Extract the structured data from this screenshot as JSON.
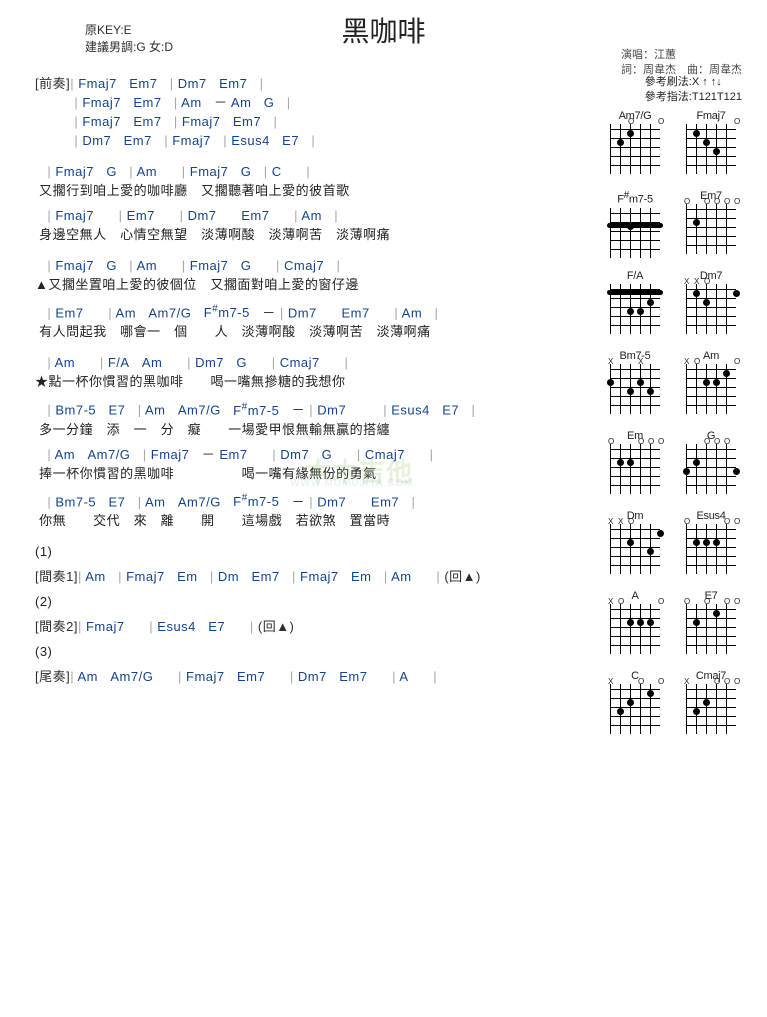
{
  "title": "黑咖啡",
  "meta": {
    "key_line1": "原KEY:E",
    "key_line2": "建議男調:G 女:D",
    "singer": "演唱：江蕙",
    "lyricist": "詞：周韋杰　曲：周韋杰"
  },
  "reference": {
    "strum": "參考刷法:X ↑ ↑↓",
    "pick": "參考指法:T121T121"
  },
  "sections": [
    {
      "type": "intro",
      "label": "[前奏]",
      "lines": [
        {
          "chords": [
            "|",
            "Fmaj7",
            "Em7",
            "|",
            "Dm7",
            "Em7",
            "|"
          ]
        },
        {
          "chords": [
            "|",
            "Fmaj7",
            "Em7",
            "|",
            "Am",
            "－",
            "Am",
            "G",
            "|"
          ]
        },
        {
          "chords": [
            "|",
            "Fmaj7",
            "Em7",
            "|",
            "Fmaj7",
            "Em7",
            "|"
          ]
        },
        {
          "chords": [
            "|",
            "Dm7",
            "Em7",
            "|",
            "Fmaj7",
            "|",
            "Esus4",
            "E7",
            "|"
          ]
        }
      ]
    },
    {
      "type": "verse",
      "lines": [
        {
          "chords": [
            "|",
            "Fmaj7",
            "G",
            "|",
            "Am",
            "",
            "|",
            "Fmaj7",
            "G",
            "|",
            "C",
            "",
            "|"
          ],
          "lyrics": "又擱行到咱上愛的咖啡廳　又擱聽著咱上愛的彼首歌"
        },
        {
          "chords": [
            "|",
            "Fmaj7",
            "",
            "|",
            "Em7",
            "",
            "|",
            "Dm7",
            "",
            "Em7",
            "",
            "|",
            "Am",
            "|"
          ],
          "lyrics": "身邊空無人　心情空無望　淡薄啊酸　淡薄啊苦　淡薄啊痛"
        }
      ]
    },
    {
      "type": "verse",
      "marker": "▲",
      "lines": [
        {
          "chords": [
            "|",
            "Fmaj7",
            "G",
            "|",
            "Am",
            "",
            "|",
            "Fmaj7",
            "G",
            "",
            "|",
            "Cmaj7",
            "|"
          ],
          "lyrics": "又擱坐置咱上愛的彼個位　又擱面對咱上愛的窗仔邊"
        },
        {
          "chords": [
            "|",
            "Em7",
            "",
            "|",
            "Am",
            "Am7/G",
            "F#m7-5",
            "－",
            "|",
            "Dm7",
            "",
            "Em7",
            "",
            "|",
            "Am",
            "|"
          ],
          "lyrics": "有人問起我　哪會一　個　　人　淡薄啊酸　淡薄啊苦　淡薄啊痛"
        }
      ]
    },
    {
      "type": "chorus",
      "marker": "★",
      "lines": [
        {
          "chords": [
            "|",
            "Am",
            "",
            "|",
            "F/A",
            "Am",
            "",
            "|",
            "Dm7",
            "G",
            "",
            "|",
            "Cmaj7",
            "",
            "|"
          ],
          "lyrics": "點一杯你慣習的黑咖啡　　喝一嘴無摻糖的我想你"
        },
        {
          "chords": [
            "|",
            "Bm7-5",
            "E7",
            "|",
            "Am",
            "Am7/G",
            "F#m7-5",
            "－",
            "|",
            "Dm7",
            "",
            "",
            "|",
            "Esus4",
            "E7",
            "|"
          ],
          "lyrics": "多一分鐘　添　一　分　癡　　一場愛甲恨無輸無贏的搭纏"
        },
        {
          "chords": [
            "|",
            "Am",
            "Am7/G",
            "|",
            "Fmaj7",
            "－",
            "Em7",
            "",
            "|",
            "Dm7",
            "G",
            "",
            "|",
            "Cmaj7",
            "",
            "|"
          ],
          "lyrics": "捧一杯你慣習的黑咖啡　　　　　喝一嘴有緣無份的勇氣"
        },
        {
          "chords": [
            "|",
            "Bm7-5",
            "E7",
            "|",
            "Am",
            "Am7/G",
            "F#m7-5",
            "－",
            "|",
            "Dm7",
            "",
            "Em7",
            "|"
          ],
          "lyrics": "你無　　交代　來　離　　開　　這場戲　若欲煞　置當時"
        }
      ]
    },
    {
      "type": "route",
      "label": "(1)",
      "lines": [
        {
          "chords": [
            "[間奏1]",
            "|",
            "Am",
            "|",
            "Fmaj7",
            "Em",
            "|",
            "Dm",
            "Em7",
            "|",
            "Fmaj7",
            "Em",
            "|",
            "Am",
            "",
            "|",
            " (回▲)"
          ]
        }
      ]
    },
    {
      "type": "route",
      "label": "(2)",
      "lines": [
        {
          "chords": [
            "[間奏2]",
            "|",
            "Fmaj7",
            "",
            "|",
            "Esus4",
            "E7",
            "",
            "|",
            " (回▲)"
          ]
        }
      ]
    },
    {
      "type": "route",
      "label": "(3)",
      "lines": [
        {
          "chords": [
            "[尾奏]",
            "|",
            "Am",
            "Am7/G",
            "",
            "|",
            "Fmaj7",
            "Em7",
            "",
            "|",
            "Dm7",
            "Em7",
            "",
            "|",
            "A",
            "",
            "|"
          ]
        }
      ]
    }
  ],
  "watermark": {
    "main": "木木吉他",
    "sub": "WWW.MUMUJITA.COM"
  },
  "diagrams": [
    {
      "name": "Am7/G",
      "dots": [
        [
          1,
          3
        ],
        [
          2,
          2
        ]
      ],
      "barre": null,
      "xo": [
        "",
        "",
        "O",
        "",
        "",
        "O"
      ]
    },
    {
      "name": "Fmaj7",
      "dots": [
        [
          1,
          2
        ],
        [
          2,
          3
        ],
        [
          3,
          4
        ]
      ],
      "barre": null,
      "xo": [
        "",
        "",
        "",
        "",
        "",
        "O"
      ]
    },
    {
      "name": "F#m7-5",
      "dots": [],
      "barre": [
        2,
        1,
        6
      ],
      "xo": [
        "",
        "",
        "",
        "",
        "",
        ""
      ],
      "extra": [
        [
          2,
          3
        ]
      ]
    },
    {
      "name": "Em7",
      "dots": [
        [
          2,
          2
        ]
      ],
      "barre": null,
      "xo": [
        "O",
        "",
        "O",
        "O",
        "O",
        "O"
      ]
    },
    {
      "name": "F/A",
      "dots": [
        [
          2,
          5
        ],
        [
          3,
          3
        ],
        [
          3,
          4
        ]
      ],
      "barre": [
        1,
        1,
        6
      ],
      "xo": [
        "",
        "",
        "",
        "",
        "",
        ""
      ]
    },
    {
      "name": "Dm7",
      "dots": [
        [
          1,
          2
        ],
        [
          2,
          3
        ],
        [
          1,
          6
        ]
      ],
      "barre": null,
      "xo": [
        "X",
        "X",
        "O",
        "",
        "",
        ""
      ]
    },
    {
      "name": "Bm7-5",
      "dots": [
        [
          2,
          1
        ],
        [
          3,
          3
        ],
        [
          2,
          4
        ]
      ],
      "barre": null,
      "xo": [
        "X",
        "",
        "",
        "X",
        "",
        ""
      ],
      "extra": [
        [
          3,
          5
        ]
      ]
    },
    {
      "name": "Am",
      "dots": [
        [
          2,
          3
        ],
        [
          2,
          4
        ],
        [
          1,
          5
        ]
      ],
      "barre": null,
      "xo": [
        "X",
        "O",
        "",
        "",
        "",
        "O"
      ]
    },
    {
      "name": "Em",
      "dots": [
        [
          2,
          2
        ],
        [
          2,
          3
        ]
      ],
      "barre": null,
      "xo": [
        "O",
        "",
        "",
        "O",
        "O",
        "O"
      ]
    },
    {
      "name": "G",
      "dots": [
        [
          3,
          1
        ],
        [
          2,
          2
        ],
        [
          3,
          6
        ]
      ],
      "barre": null,
      "xo": [
        "",
        "",
        "O",
        "O",
        "O",
        ""
      ]
    },
    {
      "name": "Dm",
      "dots": [
        [
          2,
          3
        ],
        [
          3,
          5
        ],
        [
          1,
          6
        ]
      ],
      "barre": null,
      "xo": [
        "X",
        "X",
        "O",
        "",
        "",
        ""
      ]
    },
    {
      "name": "Esus4",
      "dots": [
        [
          2,
          2
        ],
        [
          2,
          3
        ],
        [
          2,
          4
        ]
      ],
      "barre": null,
      "xo": [
        "O",
        "",
        "",
        "",
        "O",
        "O"
      ]
    },
    {
      "name": "A",
      "dots": [
        [
          2,
          3
        ],
        [
          2,
          4
        ],
        [
          2,
          5
        ]
      ],
      "barre": null,
      "xo": [
        "X",
        "O",
        "",
        "",
        "",
        "O"
      ]
    },
    {
      "name": "E7",
      "dots": [
        [
          2,
          2
        ],
        [
          1,
          4
        ]
      ],
      "barre": null,
      "xo": [
        "O",
        "",
        "O",
        "",
        "O",
        "O"
      ]
    },
    {
      "name": "C",
      "dots": [
        [
          3,
          2
        ],
        [
          2,
          3
        ],
        [
          1,
          5
        ]
      ],
      "barre": null,
      "xo": [
        "X",
        "",
        "",
        "O",
        "",
        "O"
      ]
    },
    {
      "name": "Cmaj7",
      "dots": [
        [
          3,
          2
        ],
        [
          2,
          3
        ]
      ],
      "barre": null,
      "xo": [
        "X",
        "",
        "",
        "O",
        "O",
        "O"
      ]
    }
  ],
  "chart_data": null
}
